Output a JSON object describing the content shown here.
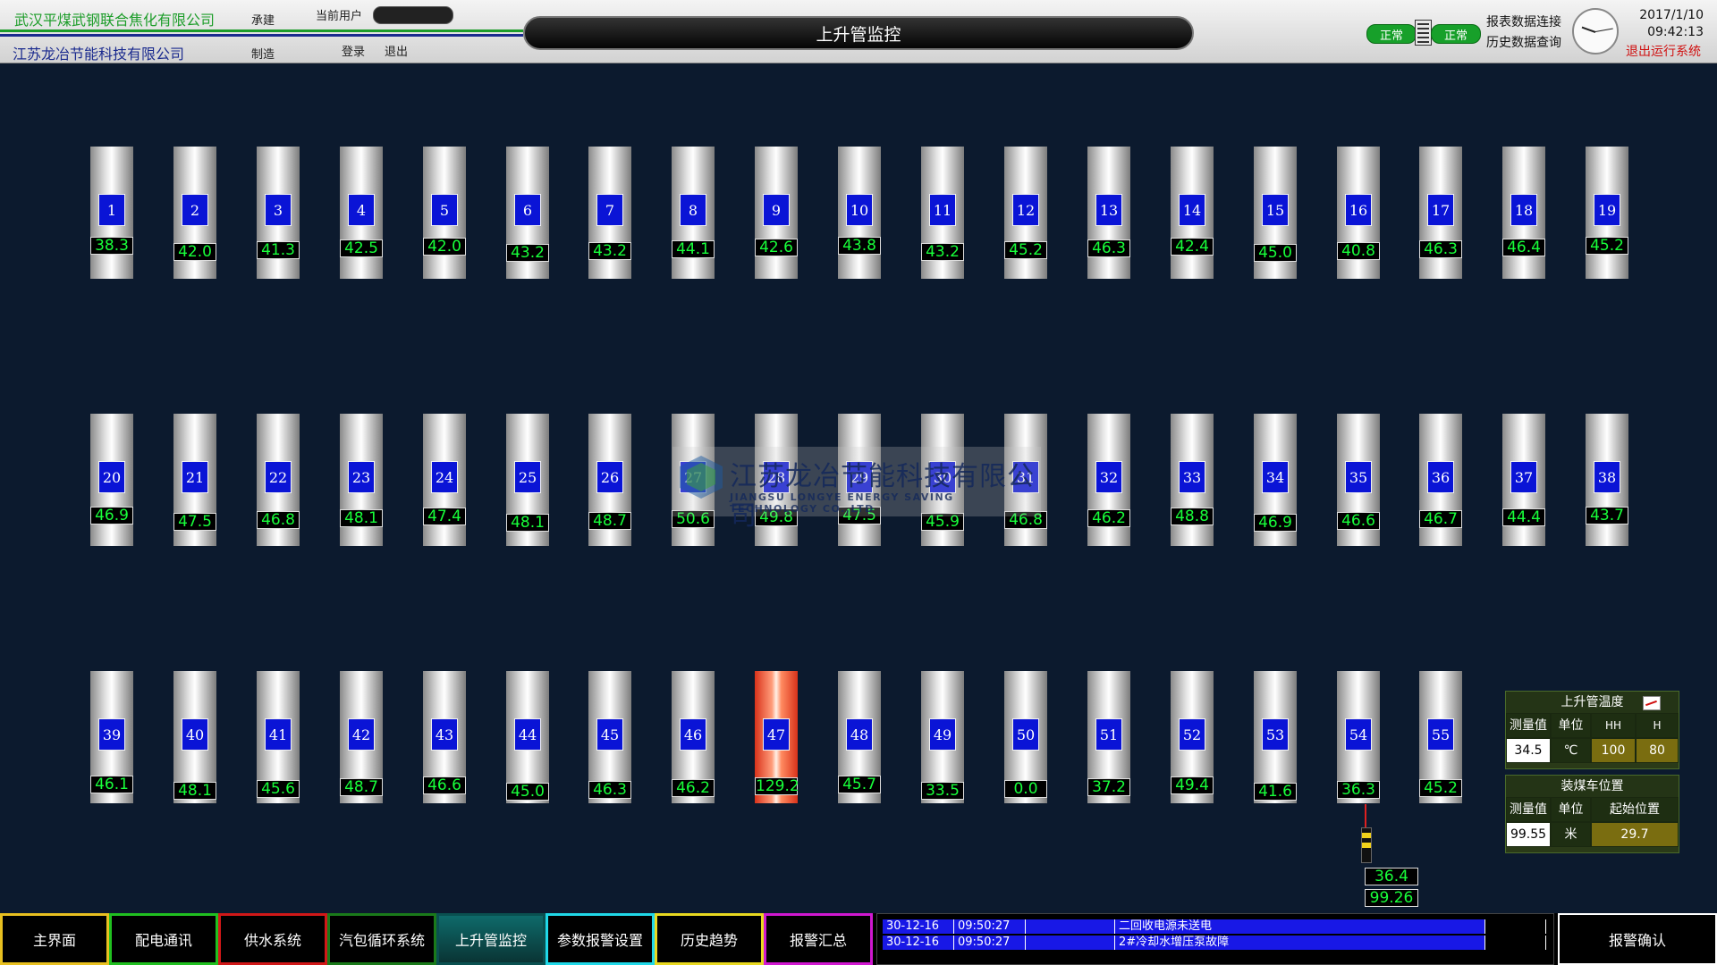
{
  "header": {
    "company_top": "武汉平煤武钢联合焦化有限公司",
    "company_bottom": "江苏龙冶节能科技有限公司",
    "role_top": "承建",
    "role_bottom": "制造",
    "current_user_label": "当前用户",
    "login": "登录",
    "logout": "退出",
    "title": "上升管监控",
    "status1": "正常",
    "status2": "正常",
    "report_link": "报表数据连接",
    "history_link": "历史数据查询",
    "date": "2017/1/10",
    "time": "09:42:13",
    "exit_system": "退出运行系统"
  },
  "pipes": [
    {
      "id": "1",
      "value": "38.3"
    },
    {
      "id": "2",
      "value": "42.0"
    },
    {
      "id": "3",
      "value": "41.3"
    },
    {
      "id": "4",
      "value": "42.5"
    },
    {
      "id": "5",
      "value": "42.0"
    },
    {
      "id": "6",
      "value": "43.2"
    },
    {
      "id": "7",
      "value": "43.2"
    },
    {
      "id": "8",
      "value": "44.1"
    },
    {
      "id": "9",
      "value": "42.6"
    },
    {
      "id": "10",
      "value": "43.8"
    },
    {
      "id": "11",
      "value": "43.2"
    },
    {
      "id": "12",
      "value": "45.2"
    },
    {
      "id": "13",
      "value": "46.3"
    },
    {
      "id": "14",
      "value": "42.4"
    },
    {
      "id": "15",
      "value": "45.0"
    },
    {
      "id": "16",
      "value": "40.8"
    },
    {
      "id": "17",
      "value": "46.3"
    },
    {
      "id": "18",
      "value": "46.4"
    },
    {
      "id": "19",
      "value": "45.2"
    },
    {
      "id": "20",
      "value": "46.9"
    },
    {
      "id": "21",
      "value": "47.5"
    },
    {
      "id": "22",
      "value": "46.8"
    },
    {
      "id": "23",
      "value": "48.1"
    },
    {
      "id": "24",
      "value": "47.4"
    },
    {
      "id": "25",
      "value": "48.1"
    },
    {
      "id": "26",
      "value": "48.7"
    },
    {
      "id": "27",
      "value": "50.6"
    },
    {
      "id": "28",
      "value": "49.8"
    },
    {
      "id": "29",
      "value": "47.5"
    },
    {
      "id": "30",
      "value": "45.9"
    },
    {
      "id": "31",
      "value": "46.8"
    },
    {
      "id": "32",
      "value": "46.2"
    },
    {
      "id": "33",
      "value": "48.8"
    },
    {
      "id": "34",
      "value": "46.9"
    },
    {
      "id": "35",
      "value": "46.6"
    },
    {
      "id": "36",
      "value": "46.7"
    },
    {
      "id": "37",
      "value": "44.4"
    },
    {
      "id": "38",
      "value": "43.7"
    },
    {
      "id": "39",
      "value": "46.1"
    },
    {
      "id": "40",
      "value": "48.1"
    },
    {
      "id": "41",
      "value": "45.6"
    },
    {
      "id": "42",
      "value": "48.7"
    },
    {
      "id": "43",
      "value": "46.6"
    },
    {
      "id": "44",
      "value": "45.0"
    },
    {
      "id": "45",
      "value": "46.3"
    },
    {
      "id": "46",
      "value": "46.2"
    },
    {
      "id": "47",
      "value": "129.2",
      "alarm": true
    },
    {
      "id": "48",
      "value": "45.7"
    },
    {
      "id": "49",
      "value": "33.5"
    },
    {
      "id": "50",
      "value": "0.0"
    },
    {
      "id": "51",
      "value": "37.2"
    },
    {
      "id": "52",
      "value": "49.4"
    },
    {
      "id": "53",
      "value": "41.6"
    },
    {
      "id": "54",
      "value": "36.3"
    },
    {
      "id": "55",
      "value": "45.2"
    }
  ],
  "watermark": {
    "cn": "江苏龙冶节能科技有限公司",
    "en": "JIANGSU LONGYE ENERGY SAVING TECHNOLOGY CO.,LTD"
  },
  "cart": {
    "value1": "36.4",
    "value2": "99.26"
  },
  "temp_panel": {
    "title": "上升管温度",
    "col_measure": "测量值",
    "col_unit": "单位",
    "col_hh": "HH",
    "col_h": "H",
    "measure": "34.5",
    "unit": "℃",
    "hh": "100",
    "h": "80"
  },
  "cart_panel": {
    "title": "装煤车位置",
    "col_measure": "测量值",
    "col_unit": "单位",
    "col_start": "起始位置",
    "measure": "99.55",
    "unit": "米",
    "start": "29.7"
  },
  "nav": [
    {
      "label": "主界面",
      "color": "#e8c020"
    },
    {
      "label": "配电通讯",
      "color": "#20c020"
    },
    {
      "label": "供水系统",
      "color": "#d01818"
    },
    {
      "label": "汽包循环系统",
      "color": "#1a7a1a"
    },
    {
      "label": "上升管监控",
      "color": "#0a5050",
      "active": true
    },
    {
      "label": "参数报警设置",
      "color": "#20d8e8"
    },
    {
      "label": "历史趋势",
      "color": "#e8d820"
    },
    {
      "label": "报警汇总",
      "color": "#d018d0"
    }
  ],
  "alarms": [
    {
      "date": "30-12-16",
      "time": "09:50:27",
      "msg": "二回收电源未送电"
    },
    {
      "date": "30-12-16",
      "time": "09:50:27",
      "msg": "2#冷却水增压泵故障"
    }
  ],
  "ack_label": "报警确认"
}
